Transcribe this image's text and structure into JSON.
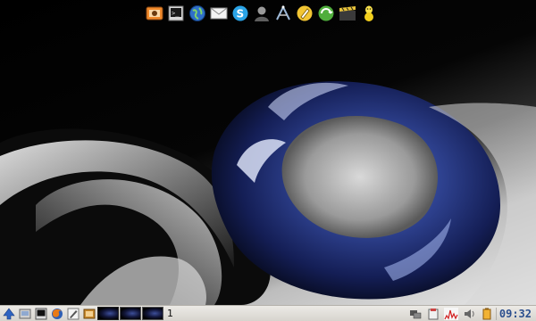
{
  "desktop": {
    "dock_icons": [
      {
        "icon": "photo-viewer-icon"
      },
      {
        "icon": "terminal-icon"
      },
      {
        "icon": "web-browser-icon"
      },
      {
        "icon": "mail-icon"
      },
      {
        "icon": "skype-icon"
      },
      {
        "icon": "user-account-icon"
      },
      {
        "icon": "graphics-editor-icon"
      },
      {
        "icon": "pencil-editor-icon"
      },
      {
        "icon": "update-manager-icon"
      },
      {
        "icon": "video-clapper-icon"
      },
      {
        "icon": "chat-messenger-icon"
      }
    ]
  },
  "panel": {
    "workspace_number": "1",
    "clock": "09:32",
    "colors": {
      "clock": "#2b4f8e",
      "panel_bg": "#e3e0db"
    }
  }
}
